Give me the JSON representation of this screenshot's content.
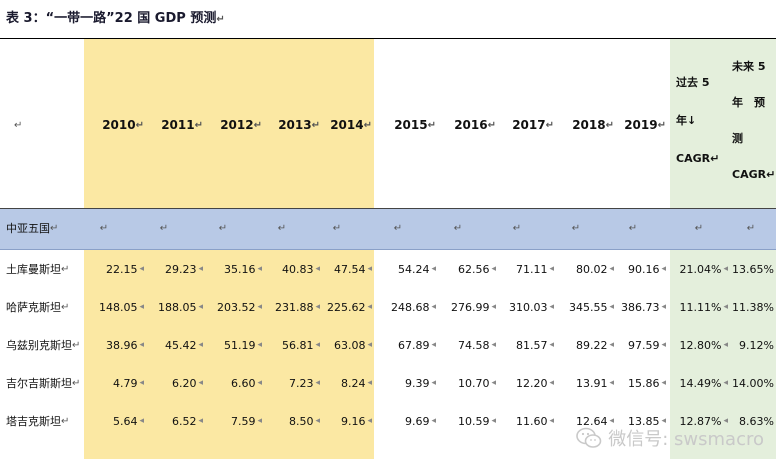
{
  "caption": "表 3：“一带一路”22 国 GDP 预测",
  "para_mark": "↵",
  "row_mark": "◂",
  "years": [
    "2010",
    "2011",
    "2012",
    "2013",
    "2014",
    "2015",
    "2016",
    "2017",
    "2018",
    "2019"
  ],
  "cagr_past": [
    "过去 5",
    "年↓",
    "CAGR↵"
  ],
  "cagr_future": [
    "未来 5",
    "年　预",
    "测",
    "CAGR↵"
  ],
  "group": "中亚五国",
  "rows": [
    {
      "name": "土库曼斯坦",
      "values": [
        "22.15",
        "29.23",
        "35.16",
        "40.83",
        "47.54",
        "54.24",
        "62.56",
        "71.11",
        "80.02",
        "90.16"
      ],
      "cagr_past": "21.04%",
      "cagr_future": "13.65%"
    },
    {
      "name": "哈萨克斯坦",
      "values": [
        "148.05",
        "188.05",
        "203.52",
        "231.88",
        "225.62",
        "248.68",
        "276.99",
        "310.03",
        "345.55",
        "386.73"
      ],
      "cagr_past": "11.11%",
      "cagr_future": "11.38%"
    },
    {
      "name": "乌兹别克斯坦",
      "values": [
        "38.96",
        "45.42",
        "51.19",
        "56.81",
        "63.08",
        "67.89",
        "74.58",
        "81.57",
        "89.22",
        "97.59"
      ],
      "cagr_past": "12.80%",
      "cagr_future": "9.12%"
    },
    {
      "name": "吉尔吉斯斯坦",
      "values": [
        "4.79",
        "6.20",
        "6.60",
        "7.23",
        "8.24",
        "9.39",
        "10.70",
        "12.20",
        "13.91",
        "15.86"
      ],
      "cagr_past": "14.49%",
      "cagr_future": "14.00%"
    },
    {
      "name": "塔吉克斯坦",
      "values": [
        "5.64",
        "6.52",
        "7.59",
        "8.50",
        "9.16",
        "9.69",
        "10.59",
        "11.60",
        "12.64",
        "13.85"
      ],
      "cagr_past": "12.87%",
      "cagr_future": "8.63%"
    }
  ],
  "watermark": "微信号: swsmacro",
  "colors": {
    "yellow": "#fbe8a3",
    "green": "#e4efdc",
    "band": "#b8c9e6"
  }
}
